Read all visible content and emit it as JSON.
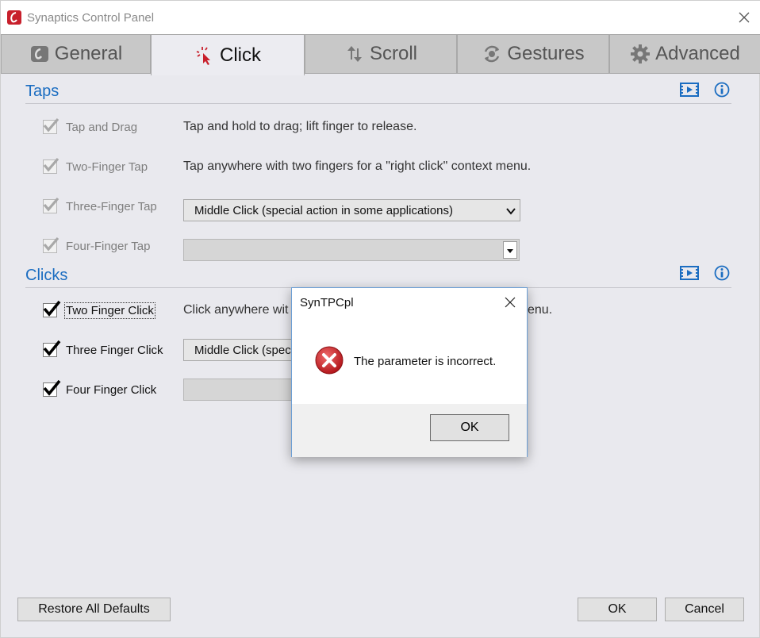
{
  "window": {
    "title": "Synaptics Control Panel",
    "icons": {
      "app": "synaptics-logo-icon",
      "close": "close-icon"
    }
  },
  "tabs": [
    {
      "label": "General",
      "icon": "touchpad-icon",
      "active": false
    },
    {
      "label": "Click",
      "icon": "cursor-click-icon",
      "active": true
    },
    {
      "label": "Scroll",
      "icon": "scroll-arrows-icon",
      "active": false
    },
    {
      "label": "Gestures",
      "icon": "gestures-icon",
      "active": false
    },
    {
      "label": "Advanced",
      "icon": "gear-icon",
      "active": false
    }
  ],
  "taps": {
    "title": "Taps",
    "icons": [
      "video-icon",
      "info-icon"
    ],
    "items": [
      {
        "label": "Tap and Drag",
        "checked": true,
        "enabled": false,
        "description": "Tap and hold to drag; lift finger to release."
      },
      {
        "label": "Two-Finger Tap",
        "checked": true,
        "enabled": false,
        "description": "Tap anywhere with two fingers for a \"right click\" context menu."
      },
      {
        "label": "Three-Finger Tap",
        "checked": true,
        "enabled": false,
        "select_value": "Middle Click (special action in some applications)"
      },
      {
        "label": "Four-Finger Tap",
        "checked": true,
        "enabled": false,
        "select_value": ""
      }
    ]
  },
  "clicks": {
    "title": "Clicks",
    "icons": [
      "video-icon",
      "info-icon"
    ],
    "items": [
      {
        "label": "Two Finger Click",
        "checked": true,
        "description_start": "Click anywhere wit",
        "description_end": "enu."
      },
      {
        "label": "Three Finger Click",
        "checked": true,
        "select_value": "Middle Click (spec"
      },
      {
        "label": "Four Finger Click",
        "checked": true,
        "select_value": ""
      }
    ]
  },
  "footer": {
    "restore_label": "Restore All Defaults",
    "ok_label": "OK",
    "cancel_label": "Cancel"
  },
  "dialog": {
    "title": "SynTPCpl",
    "message": "The parameter is incorrect.",
    "ok_label": "OK",
    "icon": "error-icon",
    "colors": {
      "error": "#d9262b"
    }
  },
  "colors": {
    "accent": "#1b6dc1",
    "window_bg": "#e9e9ee",
    "tab_inactive": "#c8c8c8"
  }
}
